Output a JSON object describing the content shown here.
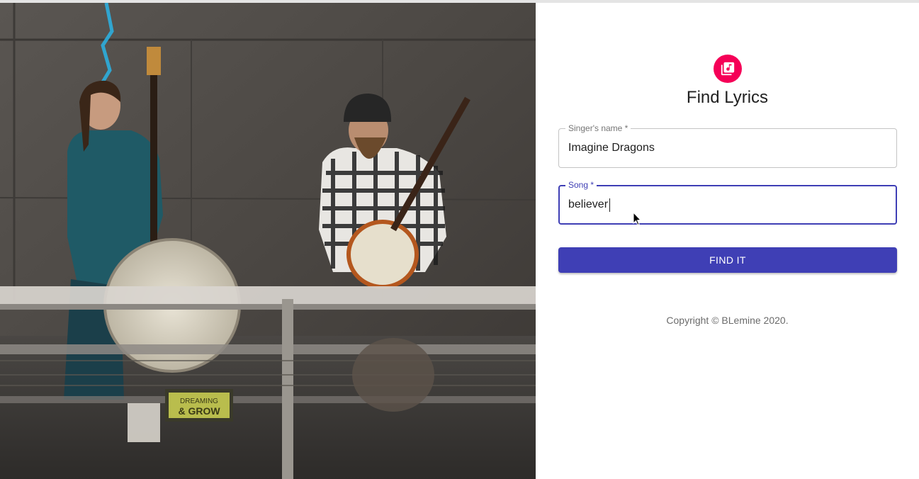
{
  "form": {
    "title": "Find Lyrics",
    "singer": {
      "label": "Singer's name *",
      "value": "Imagine Dragons"
    },
    "song": {
      "label": "Song *",
      "value": "believer"
    },
    "submit_label": "FIND IT",
    "copyright": "Copyright © BLemine 2020."
  },
  "hero": {
    "sign_line1": "DREAMING",
    "sign_line2": "& GROW"
  },
  "icons": {
    "logo": "music-library-icon",
    "logo_color": "#f50057"
  },
  "colors": {
    "accent": "#3f3fb5"
  }
}
